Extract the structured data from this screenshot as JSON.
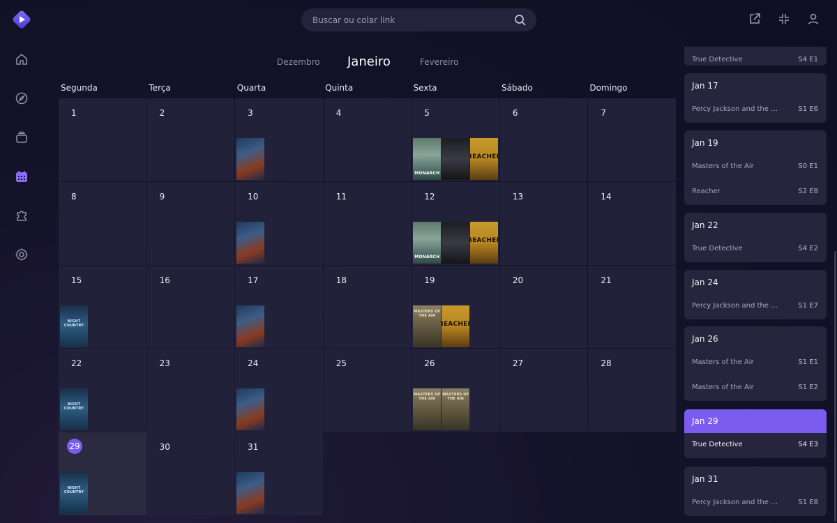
{
  "search": {
    "placeholder": "Buscar ou colar link"
  },
  "nav": [
    "home-icon",
    "compass-icon",
    "library-icon",
    "calendar-icon",
    "addons-icon",
    "settings-icon"
  ],
  "months": {
    "prev": "Dezembro",
    "current": "Janeiro",
    "next": "Fevereiro"
  },
  "weekdays": [
    "Segunda",
    "Terça",
    "Quarta",
    "Quinta",
    "Sexta",
    "Sábado",
    "Domingo"
  ],
  "days": [
    {
      "n": "1",
      "posters": []
    },
    {
      "n": "2",
      "posters": []
    },
    {
      "n": "3",
      "posters": [
        "percy"
      ]
    },
    {
      "n": "4",
      "posters": []
    },
    {
      "n": "5",
      "posters": [
        "monarch",
        "fellow",
        "reacher"
      ]
    },
    {
      "n": "6",
      "posters": []
    },
    {
      "n": "7",
      "posters": []
    },
    {
      "n": "8",
      "posters": []
    },
    {
      "n": "9",
      "posters": []
    },
    {
      "n": "10",
      "posters": [
        "percy"
      ]
    },
    {
      "n": "11",
      "posters": []
    },
    {
      "n": "12",
      "posters": [
        "monarch",
        "fellow",
        "reacher"
      ]
    },
    {
      "n": "13",
      "posters": []
    },
    {
      "n": "14",
      "posters": []
    },
    {
      "n": "15",
      "posters": [
        "night"
      ]
    },
    {
      "n": "16",
      "posters": []
    },
    {
      "n": "17",
      "posters": [
        "percy"
      ]
    },
    {
      "n": "18",
      "posters": []
    },
    {
      "n": "19",
      "posters": [
        "masters",
        "reacher"
      ]
    },
    {
      "n": "20",
      "posters": []
    },
    {
      "n": "21",
      "posters": []
    },
    {
      "n": "22",
      "posters": [
        "night"
      ]
    },
    {
      "n": "23",
      "posters": []
    },
    {
      "n": "24",
      "posters": [
        "percy"
      ]
    },
    {
      "n": "25",
      "posters": []
    },
    {
      "n": "26",
      "posters": [
        "masters",
        "masters"
      ]
    },
    {
      "n": "27",
      "posters": []
    },
    {
      "n": "28",
      "posters": []
    },
    {
      "n": "29",
      "posters": [
        "night"
      ],
      "today": true
    },
    {
      "n": "30",
      "posters": []
    },
    {
      "n": "31",
      "posters": [
        "percy"
      ]
    }
  ],
  "poster_text": {
    "percy": "",
    "night": "NIGHT COUNTRY",
    "monarch": "MONARCH",
    "fellow": "",
    "reacher": "REACHER",
    "masters": "MASTERS OF THE AIR"
  },
  "upcoming": [
    {
      "date": "",
      "episodes": [
        {
          "title": "True Detective",
          "ep": "S4 E1"
        }
      ]
    },
    {
      "date": "Jan 17",
      "episodes": [
        {
          "title": "Percy Jackson and the Olympians",
          "ep": "S1 E6"
        }
      ]
    },
    {
      "date": "Jan 19",
      "episodes": [
        {
          "title": "Masters of the Air",
          "ep": "S0 E1"
        },
        {
          "title": "Reacher",
          "ep": "S2 E8"
        }
      ]
    },
    {
      "date": "Jan 22",
      "episodes": [
        {
          "title": "True Detective",
          "ep": "S4 E2"
        }
      ]
    },
    {
      "date": "Jan 24",
      "episodes": [
        {
          "title": "Percy Jackson and the Olympians",
          "ep": "S1 E7"
        }
      ]
    },
    {
      "date": "Jan 26",
      "episodes": [
        {
          "title": "Masters of the Air",
          "ep": "S1 E1"
        },
        {
          "title": "Masters of the Air",
          "ep": "S1 E2"
        }
      ]
    },
    {
      "date": "Jan 29",
      "episodes": [
        {
          "title": "True Detective",
          "ep": "S4 E3"
        }
      ],
      "active": true
    },
    {
      "date": "Jan 31",
      "episodes": [
        {
          "title": "Percy Jackson and the Olympians",
          "ep": "S1 E8"
        }
      ]
    }
  ],
  "colors": {
    "accent": "#7a5cf0",
    "cell": "#22213a",
    "card": "#26253d"
  }
}
